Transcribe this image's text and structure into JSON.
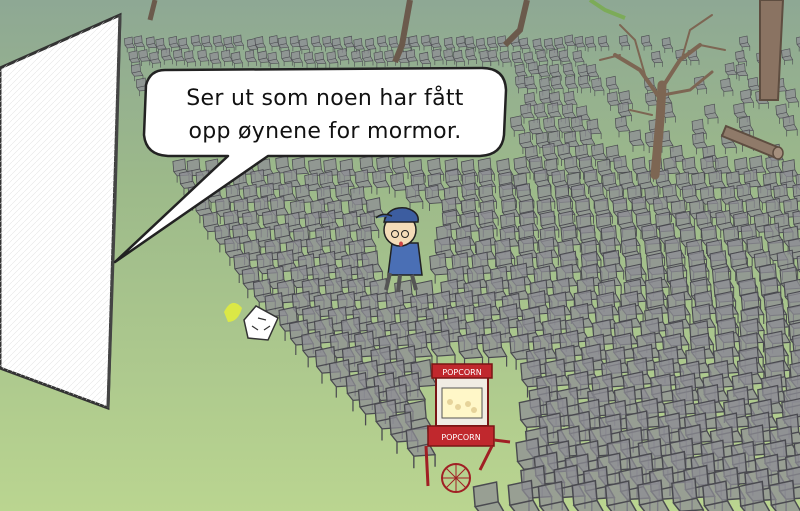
{
  "speech_bubble": {
    "line1": "Ser ut som noen har fått",
    "line2": "opp øynene for mormor."
  },
  "popcorn_cart": {
    "top_sign": "POPCORN",
    "bottom_sign": "POPCORN"
  },
  "colors": {
    "sky_top": "#8aa492",
    "grass_mid": "#9ebf86",
    "grass_bottom": "#b9d48f",
    "chair": "#8e8e94",
    "cart_red": "#c0282d",
    "cap_blue": "#3c5da0"
  }
}
